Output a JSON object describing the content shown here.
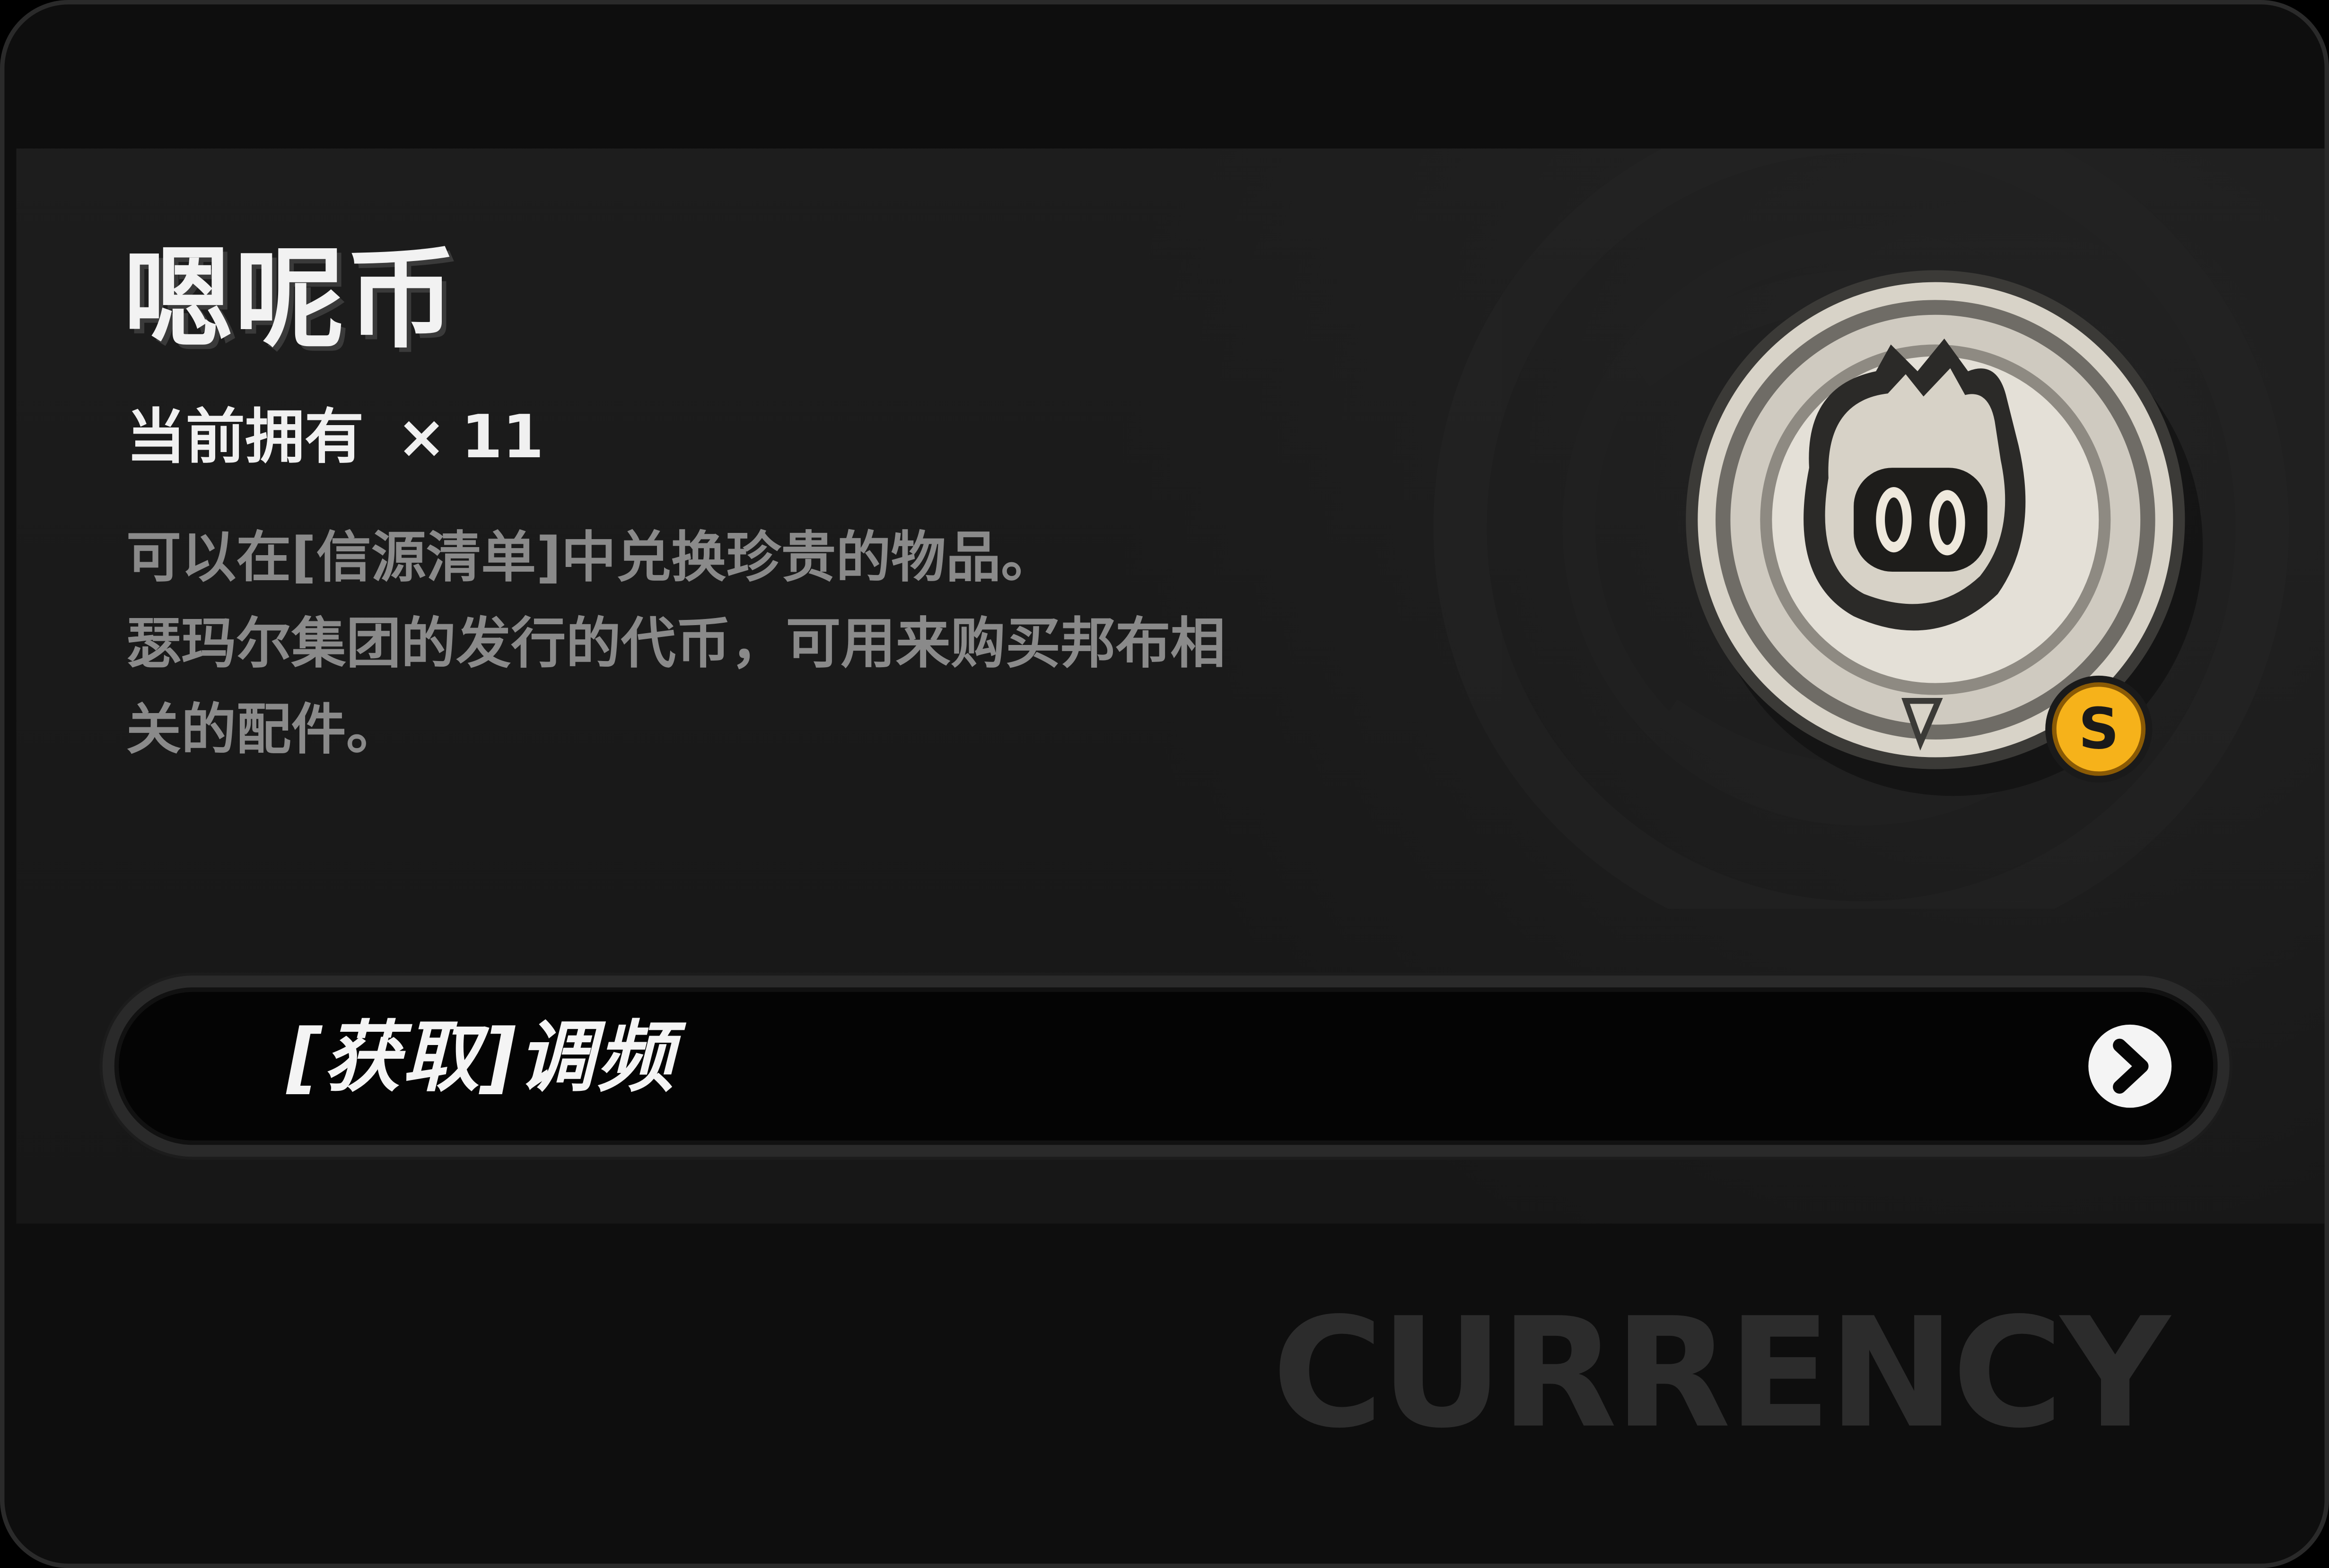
{
  "item": {
    "name": "嗯呢币",
    "owned_label": "当前拥有",
    "owned_times": "×",
    "owned_count": "11",
    "description_lines": [
      "可以在[信源清单]中兑换珍贵的物品。",
      "瑟玛尔集团的发行的代币，可用来购买邦布相",
      "关的配件。"
    ],
    "icon": "bangboo-coin-icon",
    "badge_icon": "s-rank-badge-icon",
    "badge_letter": "S"
  },
  "action": {
    "label": "[获取]调频",
    "arrow_icon": "chevron-right-icon"
  },
  "watermark": "CURRENCY",
  "colors": {
    "background": "#0e0e0e",
    "panel": "#1b1b1b",
    "title": "#f2f2f2",
    "description": "#8a8a8a",
    "badge_gold": "#f6b21a",
    "watermark": "#2c2c2c"
  }
}
